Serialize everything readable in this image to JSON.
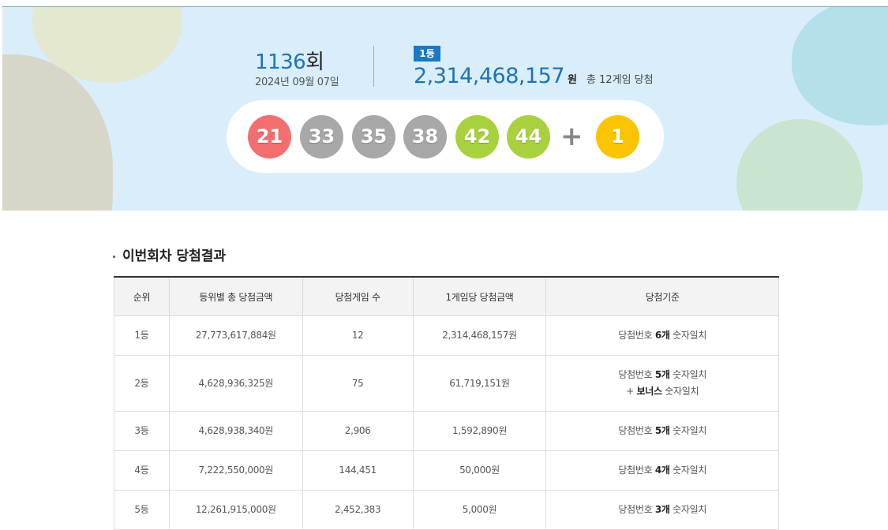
{
  "draw": {
    "number": "1136",
    "number_unit": "회",
    "date": "2024년 09월 07일"
  },
  "first_prize": {
    "badge": "1등",
    "amount": "2,314,468,157",
    "unit": "원",
    "games_text": "총 12게임 당첨"
  },
  "balls": [
    {
      "number": "21",
      "color": "#f36e6e"
    },
    {
      "number": "33",
      "color": "#a8a8a8"
    },
    {
      "number": "35",
      "color": "#a8a8a8"
    },
    {
      "number": "38",
      "color": "#a8a8a8"
    },
    {
      "number": "42",
      "color": "#a8d13e"
    },
    {
      "number": "44",
      "color": "#a8d13e"
    }
  ],
  "plus_sign": "+",
  "bonus_ball": {
    "number": "1",
    "color": "#fbc400"
  },
  "section_title": "이번회차 당첨결과",
  "table": {
    "headers": [
      "순위",
      "등위별 총 당첨금액",
      "당첨게임 수",
      "1게임당 당첨금액",
      "당첨기준"
    ],
    "rows": [
      {
        "rank": "1등",
        "total": "27,773,617,884원",
        "winners": "12",
        "per_game": "2,314,468,157원",
        "cond_prefix": "당첨번호 ",
        "cond_bold": "6개",
        "cond_suffix": " 숫자일치",
        "cond_extra_prefix": "",
        "cond_extra_bold": "",
        "cond_extra_suffix": ""
      },
      {
        "rank": "2등",
        "total": "4,628,936,325원",
        "winners": "75",
        "per_game": "61,719,151원",
        "cond_prefix": "당첨번호 ",
        "cond_bold": "5개",
        "cond_suffix": " 숫자일치",
        "cond_extra_prefix": "+ ",
        "cond_extra_bold": "보너스",
        "cond_extra_suffix": " 숫자일치"
      },
      {
        "rank": "3등",
        "total": "4,628,938,340원",
        "winners": "2,906",
        "per_game": "1,592,890원",
        "cond_prefix": "당첨번호 ",
        "cond_bold": "5개",
        "cond_suffix": " 숫자일치",
        "cond_extra_prefix": "",
        "cond_extra_bold": "",
        "cond_extra_suffix": ""
      },
      {
        "rank": "4등",
        "total": "7,222,550,000원",
        "winners": "144,451",
        "per_game": "50,000원",
        "cond_prefix": "당첨번호 ",
        "cond_bold": "4개",
        "cond_suffix": " 숫자일치",
        "cond_extra_prefix": "",
        "cond_extra_bold": "",
        "cond_extra_suffix": ""
      },
      {
        "rank": "5등",
        "total": "12,261,915,000원",
        "winners": "2,452,383",
        "per_game": "5,000원",
        "cond_prefix": "당첨번호 ",
        "cond_bold": "3개",
        "cond_suffix": " 숫자일치",
        "cond_extra_prefix": "",
        "cond_extra_bold": "",
        "cond_extra_suffix": ""
      }
    ]
  }
}
